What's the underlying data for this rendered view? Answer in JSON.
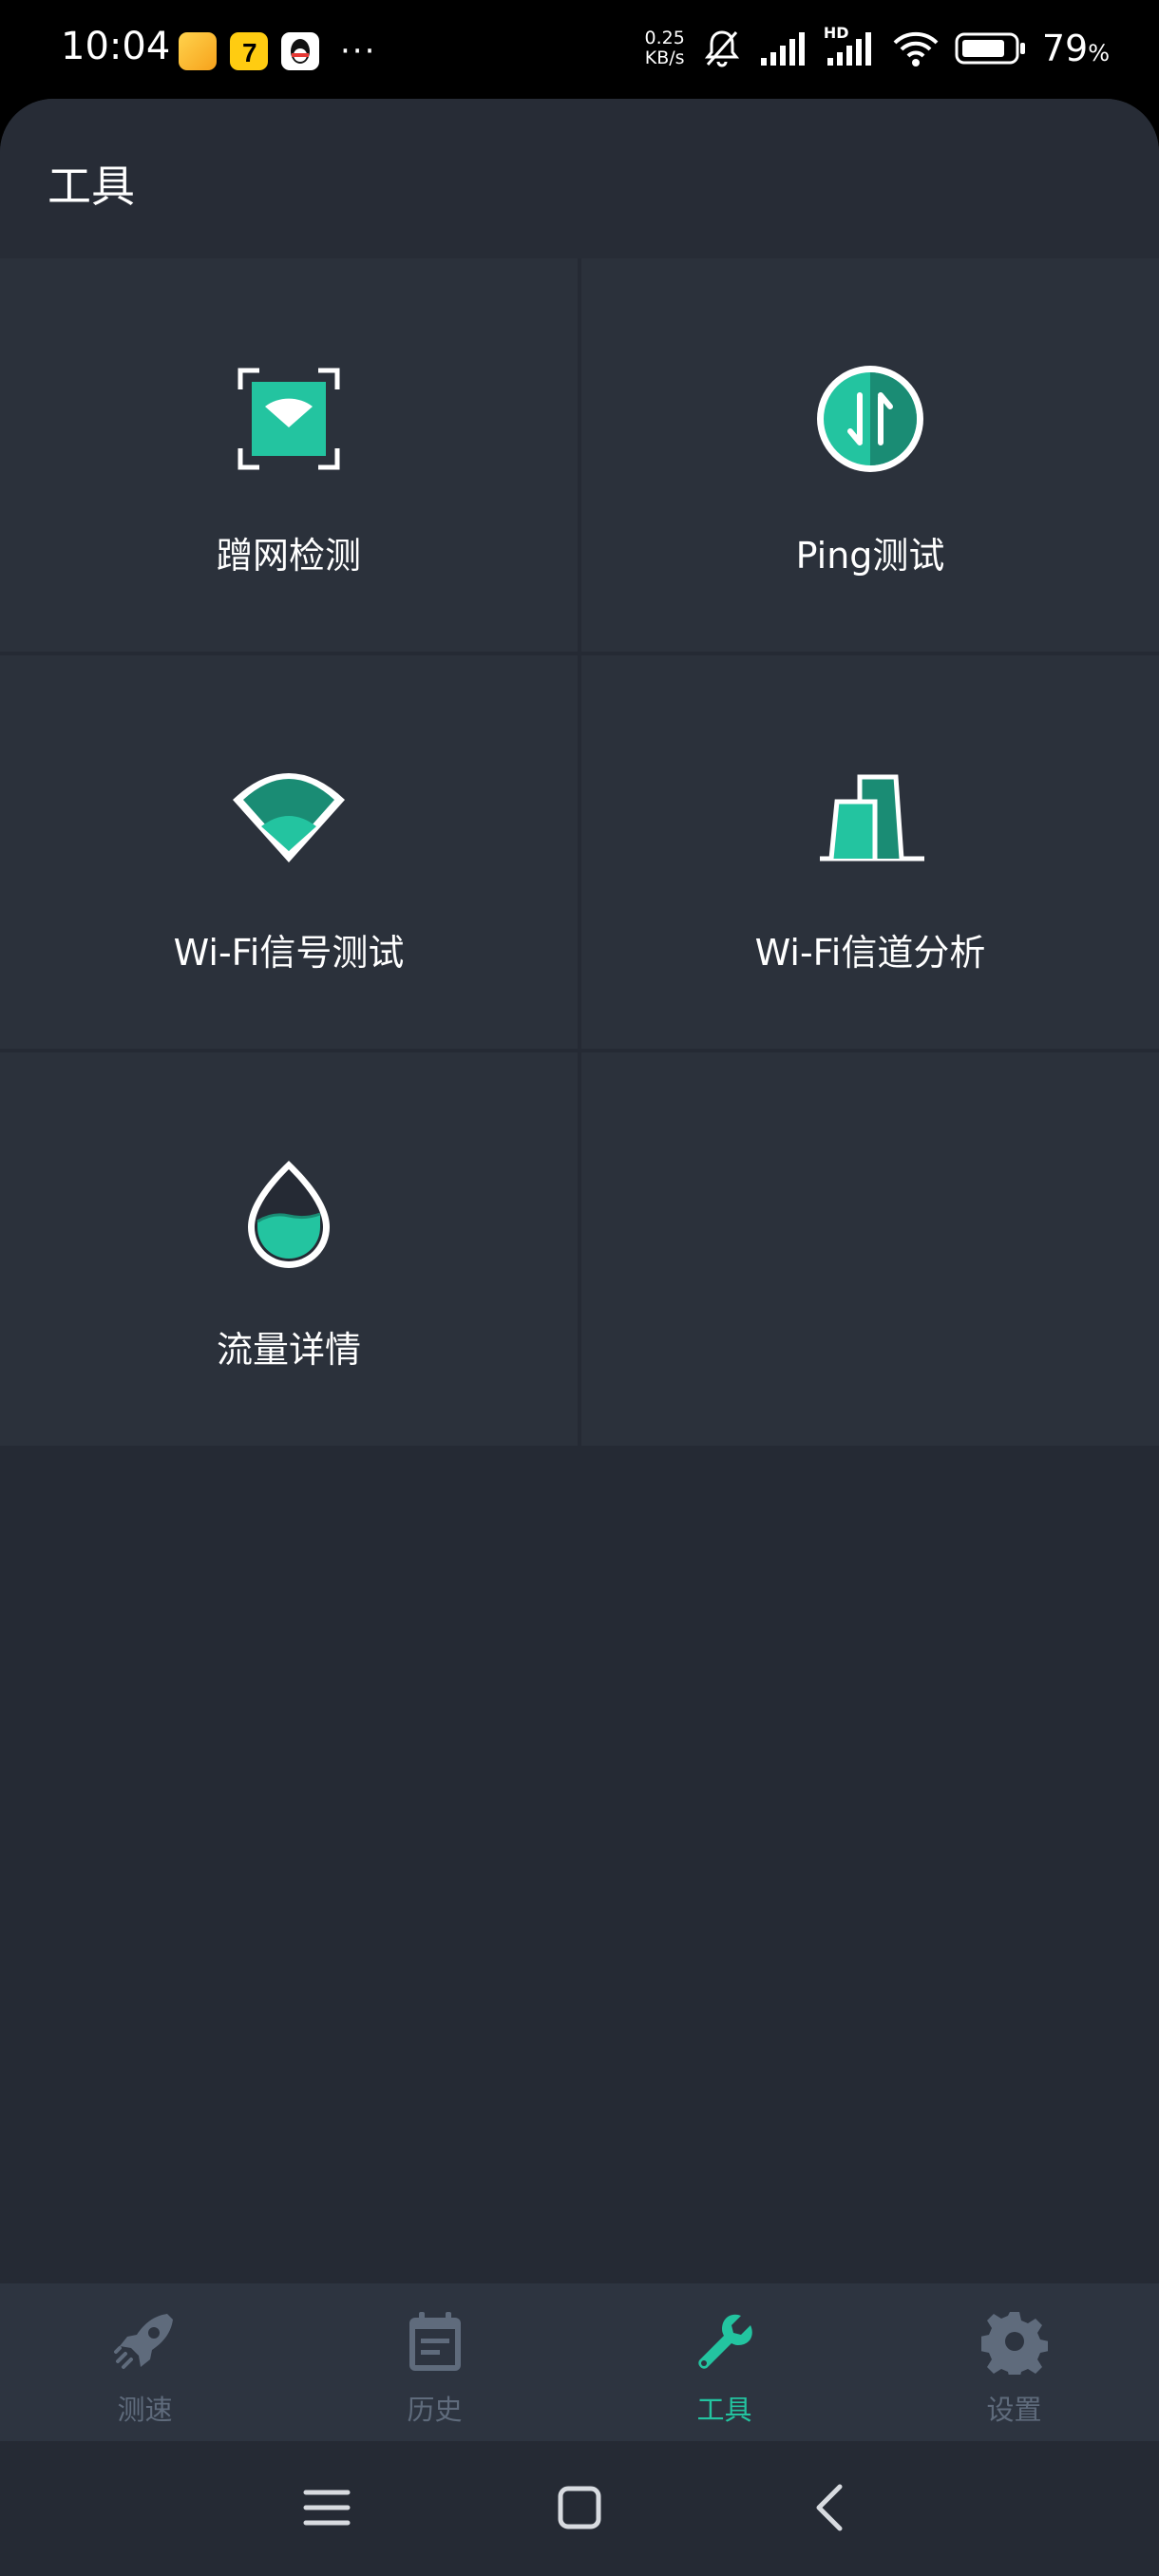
{
  "status_bar": {
    "time": "10:04",
    "net_speed_value": "0.25",
    "net_speed_unit": "KB/s",
    "hd_badge": "HD",
    "battery_percent": "79",
    "battery_percent_sign": "%",
    "more": "···"
  },
  "header": {
    "title": "工具"
  },
  "tools": [
    {
      "label": "蹭网检测",
      "icon": "wifi-scan-icon"
    },
    {
      "label": "Ping测试",
      "icon": "ping-arrows-icon"
    },
    {
      "label": "Wi-Fi信号测试",
      "icon": "wifi-signal-icon"
    },
    {
      "label": "Wi-Fi信道分析",
      "icon": "channel-bars-icon"
    },
    {
      "label": "流量详情",
      "icon": "traffic-drop-icon"
    }
  ],
  "bottom_nav": [
    {
      "label": "测速",
      "icon": "rocket-icon",
      "active": false
    },
    {
      "label": "历史",
      "icon": "calendar-icon",
      "active": false
    },
    {
      "label": "工具",
      "icon": "wrench-icon",
      "active": true
    },
    {
      "label": "设置",
      "icon": "gear-icon",
      "active": false
    }
  ],
  "colors": {
    "accent": "#23c4a0",
    "accent_dark": "#1a8c74",
    "background": "#252a34",
    "card": "#2b313b",
    "nav_inactive": "#5f6b7c"
  }
}
